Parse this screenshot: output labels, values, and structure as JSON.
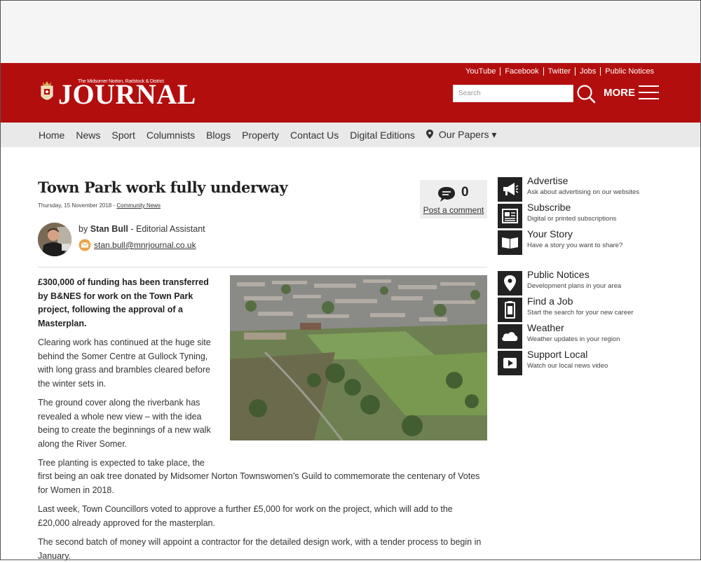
{
  "site": {
    "logo_small_text": "The Midsomer Norton, Radstock & District",
    "logo_text": "JOURNAL",
    "top_links": [
      "YouTube",
      "Facebook",
      "Twitter",
      "Jobs",
      "Public Notices"
    ],
    "search_placeholder": "Search",
    "more_label": "MORE",
    "brand_color": "#b30e0e"
  },
  "nav": {
    "items": [
      "Home",
      "News",
      "Sport",
      "Columnists",
      "Blogs",
      "Property",
      "Contact Us",
      "Digital Editions"
    ],
    "our_papers": "Our Papers ▾"
  },
  "article": {
    "title": "Town Park work fully underway",
    "date": "Thursday, 15 November 2018",
    "category": "Community News",
    "comment_count": "0",
    "comment_link": "Post a comment",
    "author_prefix": "by",
    "author_name": "Stan Bull",
    "author_role": "- Editorial Assistant",
    "author_email": "stan.bull@mnrjournal.co.uk",
    "lead": "£300,000 of funding has been transferred by B&NES for work on the Town Park project, following the approval of a Masterplan.",
    "paragraphs": [
      "Clearing work has continued at the huge site behind the Somer Centre at Gullock Tyning, with long grass and brambles cleared before the winter sets in.",
      "The ground cover along the riverbank has revealed a whole new view – with the idea being to create the beginnings of a new walk along the River Somer.",
      "Tree planting is expected to take place, the",
      "first being an oak tree donated by Midsomer Norton Townswomen’s Guild to commemorate the centenary of Votes for Women in 2018.",
      "Last week, Town Councillors voted to approve a further £5,000 for work on the project, which will add to the £20,000 already approved for the masterplan.",
      "The second batch of money will appoint a contractor for the detailed design work, with a tender process to begin in January."
    ]
  },
  "sidebar": {
    "group1": [
      {
        "title": "Advertise",
        "sub": "Ask about advertising on our websites",
        "icon": "megaphone-icon"
      },
      {
        "title": "Subscribe",
        "sub": "Digital or printed subscriptions",
        "icon": "newspaper-icon"
      },
      {
        "title": "Your Story",
        "sub": "Have a story you want to share?",
        "icon": "book-icon"
      }
    ],
    "group2": [
      {
        "title": "Public Notices",
        "sub": "Development plans in your area",
        "icon": "location-pin-icon"
      },
      {
        "title": "Find a Job",
        "sub": "Start the search for your new career",
        "icon": "briefcase-icon"
      },
      {
        "title": "Weather",
        "sub": "Weather updates in your region",
        "icon": "cloud-icon"
      },
      {
        "title": "Support Local",
        "sub": "Watch our local news video",
        "icon": "video-play-icon"
      }
    ]
  }
}
